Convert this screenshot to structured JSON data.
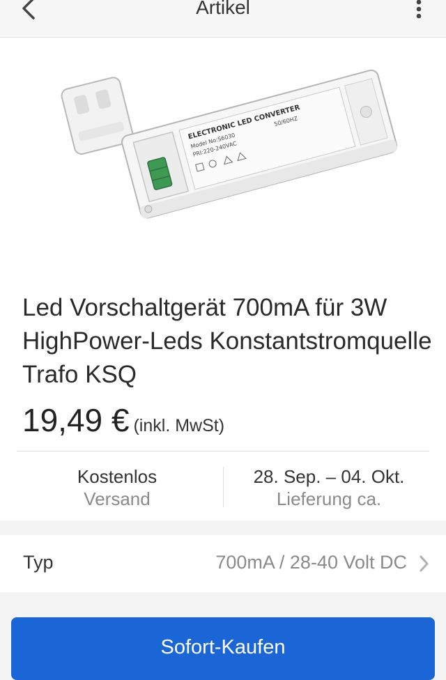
{
  "header": {
    "title": "Artikel"
  },
  "product": {
    "image_label": "ELECTRONIC LED CONVERTER",
    "image_model": "Model No:S6030",
    "image_pri": "PRI:220-240VAC",
    "image_hz": "50/60HZ",
    "title": "Led Vorschaltgerät 700mA für 3W HighPower-Leds Konstantstromquelle Trafo KSQ",
    "price": "19,49 €",
    "tax_note": "(inkl. MwSt)"
  },
  "shipping": {
    "main": "Kostenlos",
    "sub": "Versand"
  },
  "delivery": {
    "main": "28. Sep. – 04. Okt.",
    "sub": "Lieferung ca."
  },
  "variant": {
    "label": "Typ",
    "value": "700mA / 28-40 Volt DC"
  },
  "actions": {
    "buy_now": "Sofort-Kaufen"
  },
  "colors": {
    "accent": "#1b66d6",
    "secondary_text": "#8a8a8a"
  }
}
